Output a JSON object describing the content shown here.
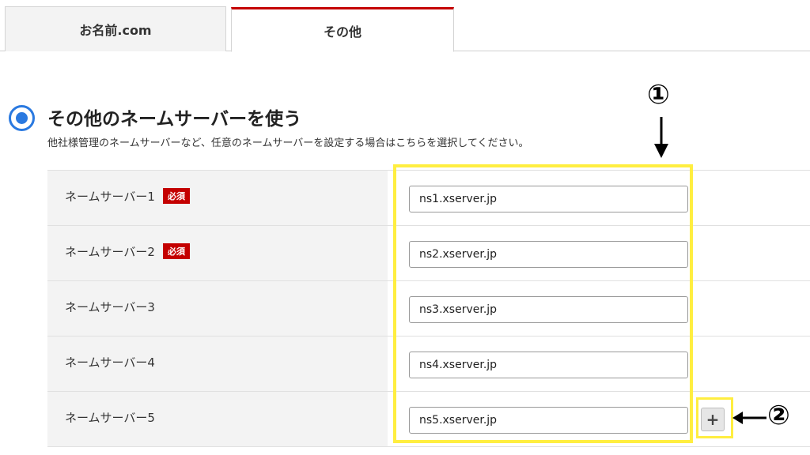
{
  "tabs": [
    {
      "label": "お名前.com"
    },
    {
      "label": "その他"
    }
  ],
  "option": {
    "title": "その他のネームサーバーを使う",
    "description": "他社様管理のネームサーバーなど、任意のネームサーバーを設定する場合はこちらを選択してください。",
    "selected": true
  },
  "required_badge": "必須",
  "nameservers": [
    {
      "label": "ネームサーバー1",
      "value": "ns1.xserver.jp",
      "required": true
    },
    {
      "label": "ネームサーバー2",
      "value": "ns2.xserver.jp",
      "required": true
    },
    {
      "label": "ネームサーバー3",
      "value": "ns3.xserver.jp",
      "required": false
    },
    {
      "label": "ネームサーバー4",
      "value": "ns4.xserver.jp",
      "required": false
    },
    {
      "label": "ネームサーバー5",
      "value": "ns5.xserver.jp",
      "required": false
    }
  ],
  "add_button": "+",
  "annotations": {
    "marker1": "①",
    "marker2": "②",
    "highlight_color": "#ffee40"
  },
  "colors": {
    "active_tab_accent": "#c40000",
    "radio": "#2a79e0",
    "badge": "#c40000"
  }
}
